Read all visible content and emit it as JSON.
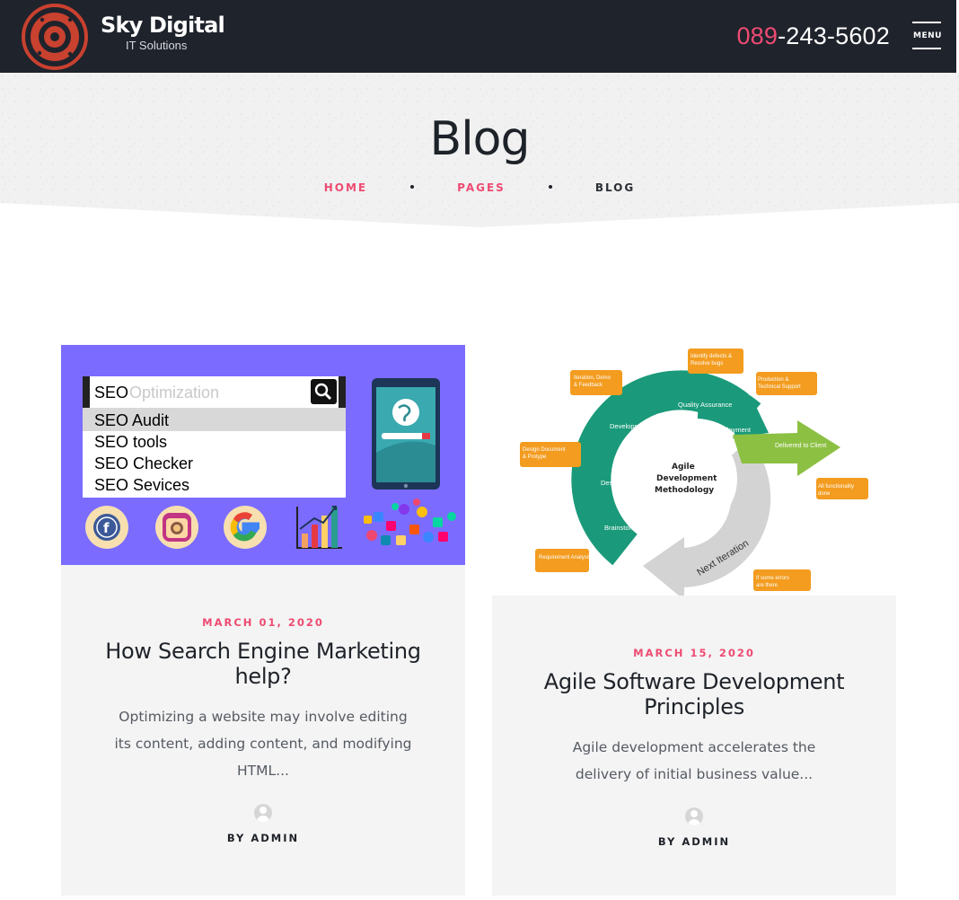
{
  "header": {
    "brand_name": "Sky Digital",
    "brand_tagline": "IT Solutions",
    "phone_prefix": "089",
    "phone_rest": "-243-5602",
    "menu_label": "MENU",
    "colors": {
      "bar": "#1f232c",
      "accent": "#ee4b72",
      "logo": "#c9412f"
    }
  },
  "hero": {
    "title": "Blog",
    "breadcrumb": [
      {
        "label": "HOME"
      },
      {
        "label": "PAGES"
      },
      {
        "label": "BLOG"
      }
    ]
  },
  "posts": [
    {
      "date": "MARCH 01, 2020",
      "title": "How Search Engine Marketing help?",
      "excerpt": "Optimizing a website may involve editing its content, adding content, and modifying HTML...",
      "author": "BY ADMIN",
      "image": {
        "search_term": "SEO",
        "search_placeholder": "Optimization",
        "suggestions": [
          "SEO Audit",
          "SEO tools",
          "SEO Checker",
          "SEO Sevices"
        ],
        "icons": [
          "facebook-icon",
          "instagram-icon",
          "google-icon",
          "bar-chart-icon",
          "app-icons-cluster"
        ]
      }
    },
    {
      "date": "MARCH 15, 2020",
      "title": "Agile Software Development Principles",
      "excerpt": "Agile development accelerates the delivery of initial business value...",
      "author": "BY ADMIN",
      "image": {
        "center_label": [
          "Agile",
          "Development",
          "Methodology"
        ],
        "stages": [
          "Development",
          "Quality Assurance",
          "Deployment",
          "Design",
          "Brainstorm"
        ],
        "next_label": "Next Iteration",
        "delivered_label": "Delivered to Client",
        "callouts": [
          "Iteration, Demo & Feedback",
          "Identify defects & Resolve bugs",
          "Production & Technical Support",
          "Design Document & Protype",
          "All functionality done",
          "Requirement Analysis",
          "If some errors are there"
        ]
      }
    }
  ]
}
